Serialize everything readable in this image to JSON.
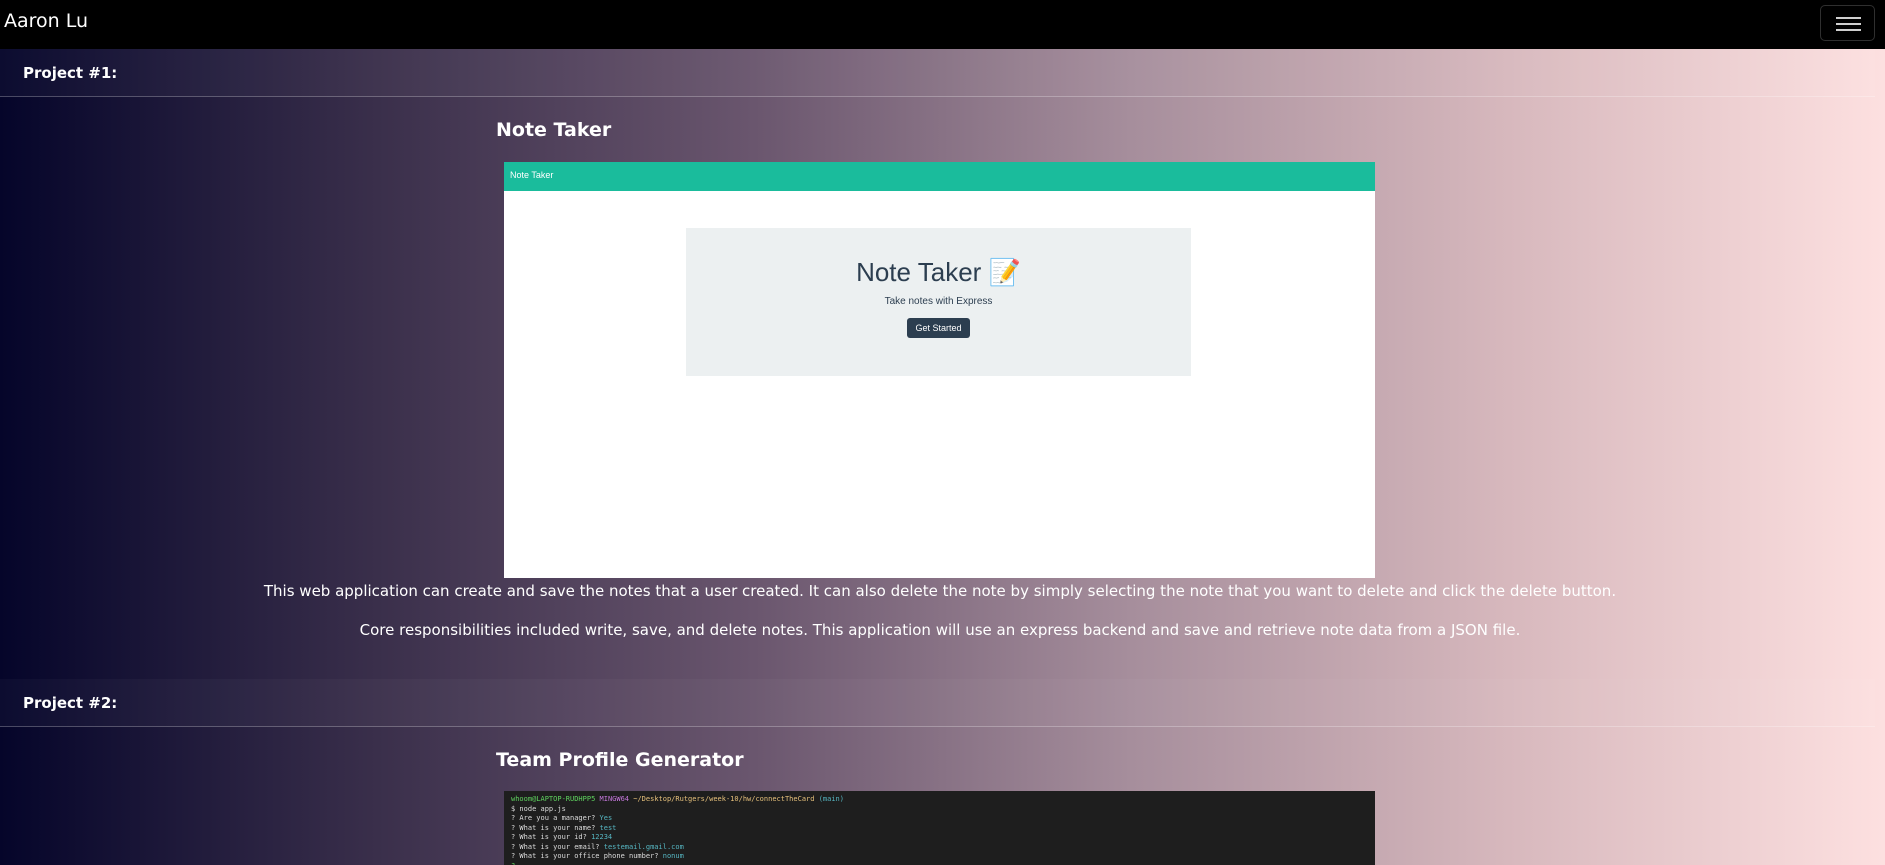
{
  "navbar": {
    "brand": "Aaron Lu",
    "toggler_icon": "hamburger-icon"
  },
  "projects": [
    {
      "header": "Project #1:",
      "title": "Note Taker",
      "screenshot": {
        "nav_title": "Note Taker",
        "heading": "Note Taker 📝",
        "subtitle": "Take notes with Express",
        "button": "Get Started",
        "nav_color": "#1abc9c"
      },
      "description": [
        "This web application can create and save the notes that a user created. It can also delete the note by simply selecting the note that you want to delete and click the delete button.",
        "Core responsibilities included write, save, and delete notes. This application will use an express backend and save and retrieve note data from a JSON file."
      ]
    },
    {
      "header": "Project #2:",
      "title": "Team Profile Generator",
      "terminal": {
        "prompt_user": "whoom@LAPTOP-RUDHPP5",
        "prompt_env": "MINGW64",
        "prompt_path": "~/Desktop/Rutgers/week-10/hw/connectTheCard",
        "prompt_branch": "(main)",
        "command": "$ node app.js",
        "lines": [
          {
            "q": "? Are you a manager?",
            "a": "Yes"
          },
          {
            "q": "? What is your name?",
            "a": "test"
          },
          {
            "q": "? What is your id?",
            "a": "12234"
          },
          {
            "q": "? What is your email?",
            "a": "testemail.gmail.com"
          },
          {
            "q": "? What is your office phone number?",
            "a": "nonum"
          }
        ],
        "cursor": "?"
      }
    }
  ]
}
